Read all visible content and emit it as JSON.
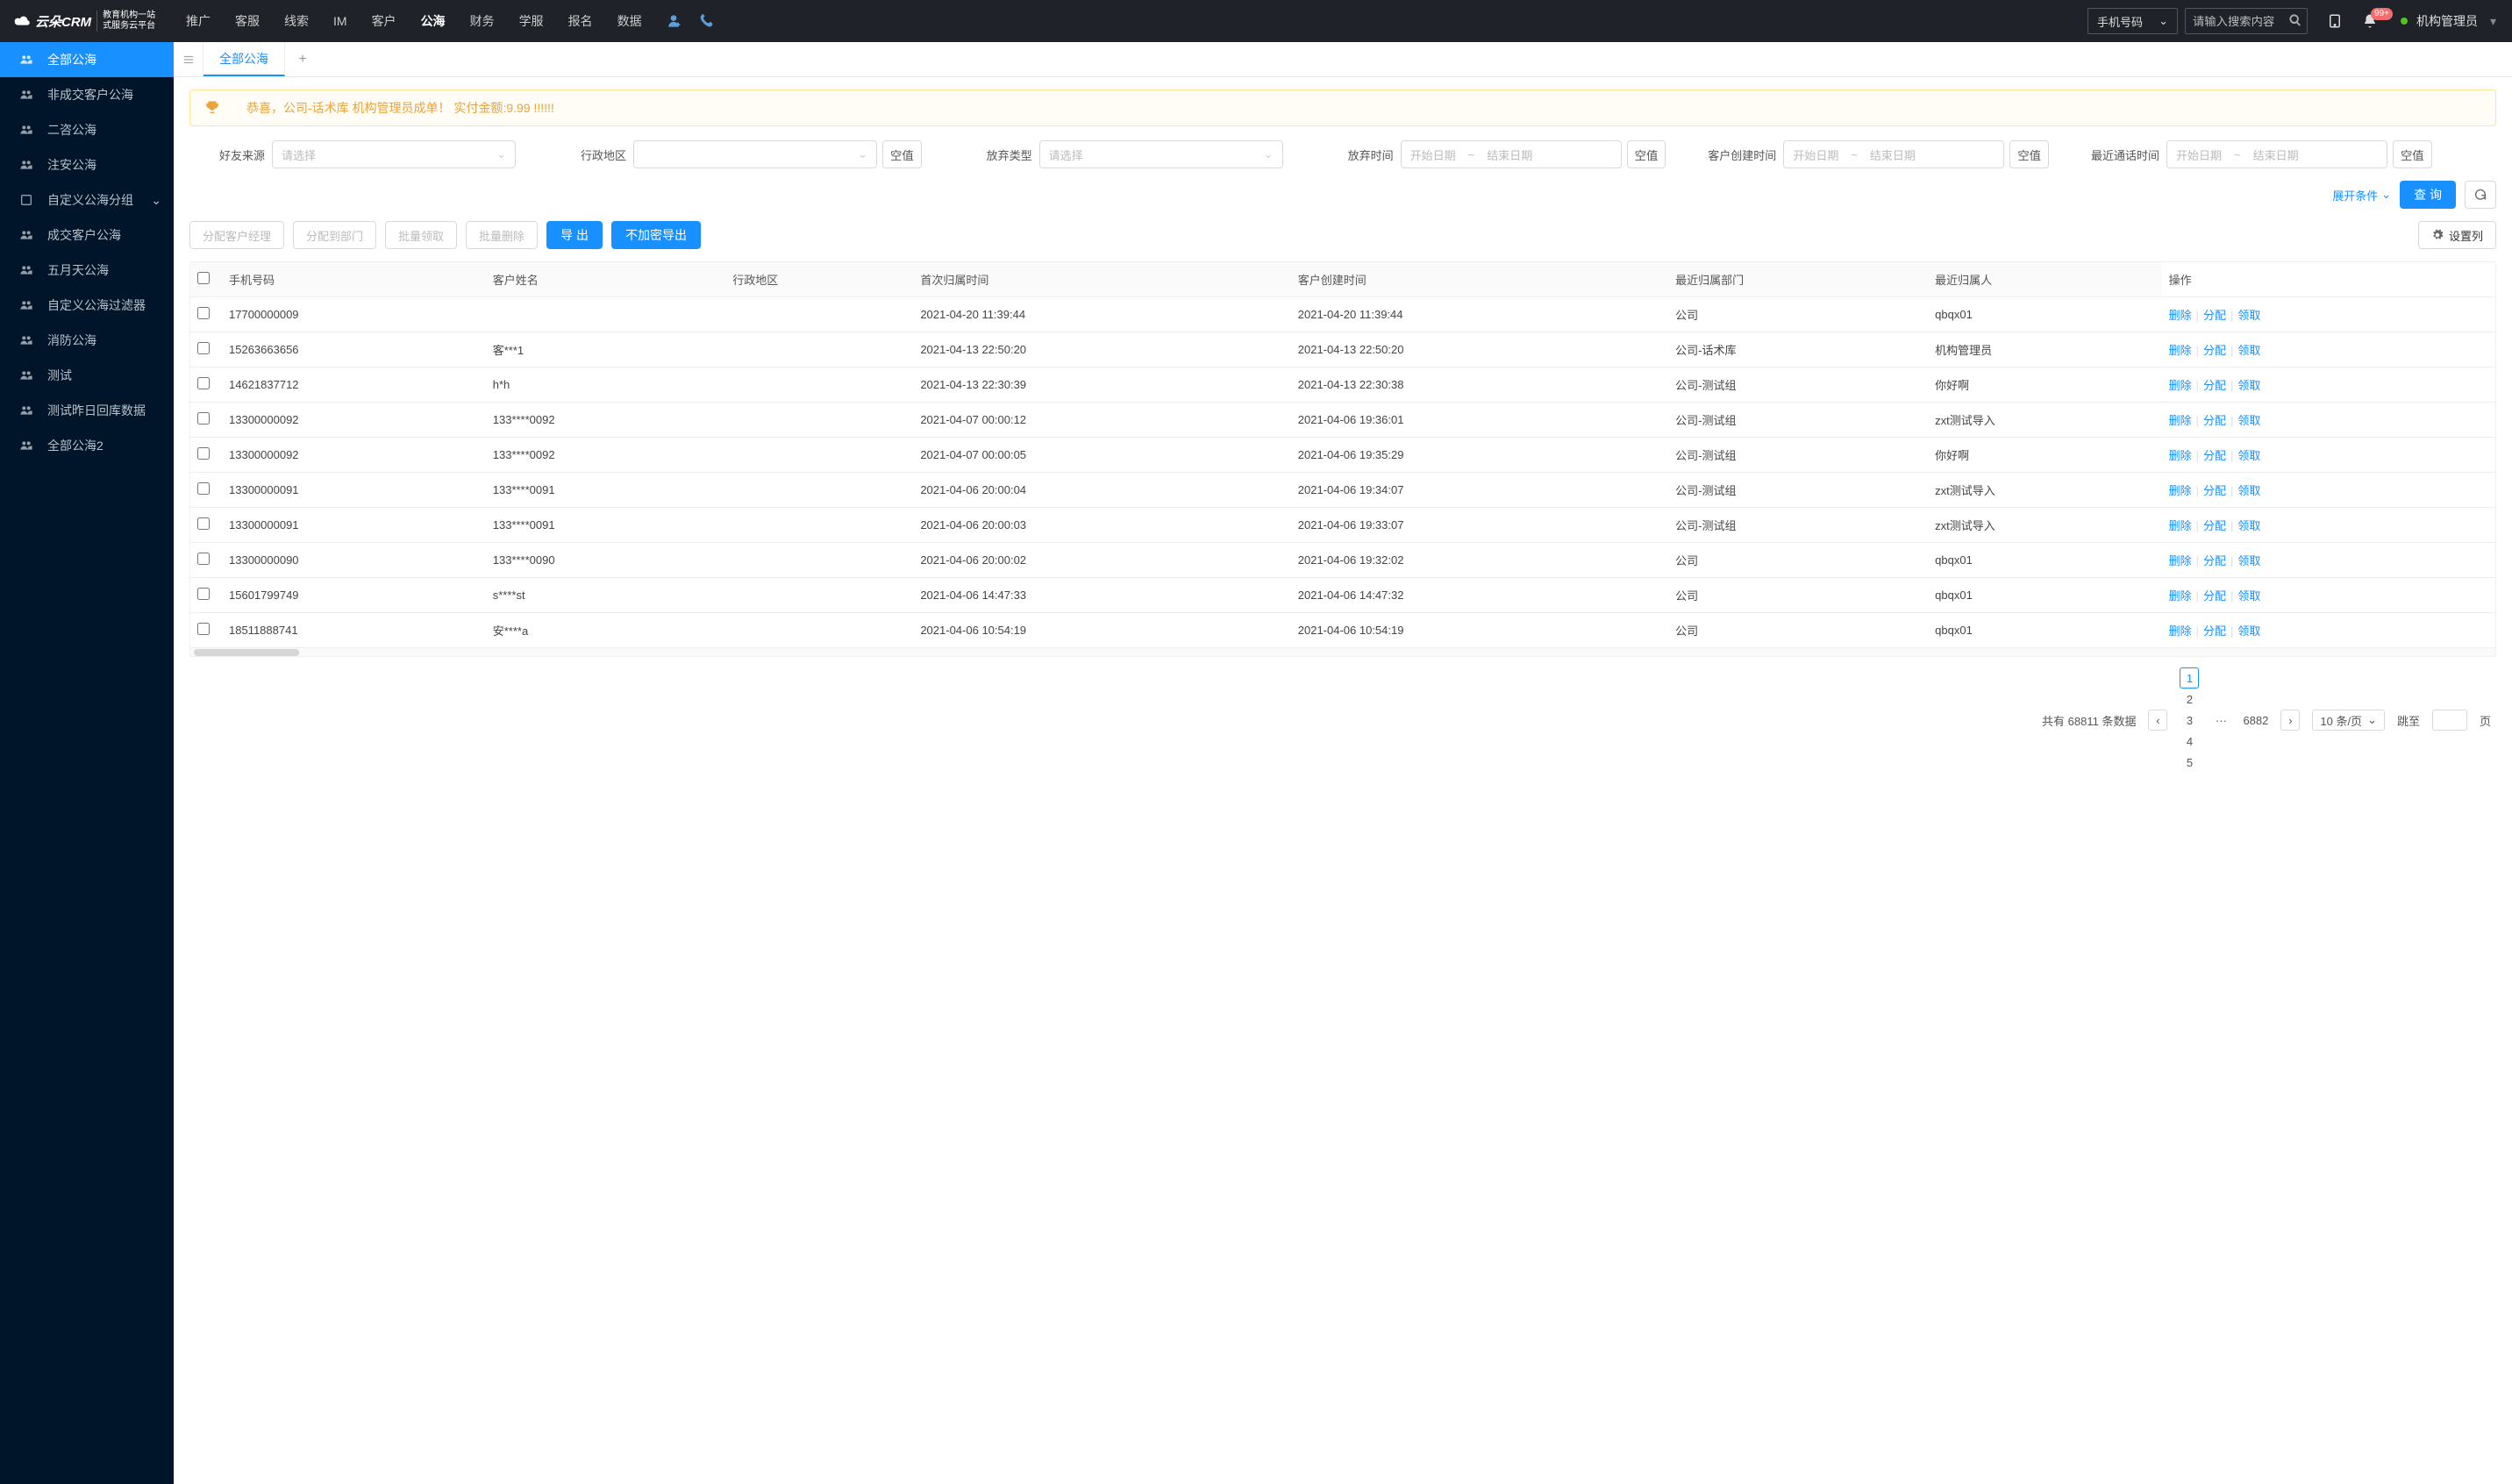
{
  "logo": {
    "main": "云朵CRM",
    "sub_url": "www.yunduocrm.com",
    "sub1": "教育机构一站",
    "sub2": "式服务云平台"
  },
  "nav": {
    "items": [
      "推广",
      "客服",
      "线索",
      "IM",
      "客户",
      "公海",
      "财务",
      "学服",
      "报名",
      "数据"
    ],
    "active": 5
  },
  "search": {
    "type": "手机号码",
    "placeholder": "请输入搜索内容"
  },
  "badge": "99+",
  "user": "机构管理员",
  "sidebar": [
    {
      "label": "全部公海",
      "icon": "users",
      "active": true
    },
    {
      "label": "非成交客户公海",
      "icon": "users"
    },
    {
      "label": "二咨公海",
      "icon": "users"
    },
    {
      "label": "注安公海",
      "icon": "users"
    },
    {
      "label": "自定义公海分组",
      "icon": "square",
      "expandable": true
    },
    {
      "label": "成交客户公海",
      "icon": "users"
    },
    {
      "label": "五月天公海",
      "icon": "users"
    },
    {
      "label": "自定义公海过滤器",
      "icon": "users"
    },
    {
      "label": "消防公海",
      "icon": "users"
    },
    {
      "label": "测试",
      "icon": "users"
    },
    {
      "label": "测试昨日回库数据",
      "icon": "users"
    },
    {
      "label": "全部公海2",
      "icon": "users"
    }
  ],
  "tab": {
    "label": "全部公海"
  },
  "banner": "恭喜，公司-话术库  机构管理员成单！  实付金额:9.99 !!!!!!",
  "filters": {
    "friend_source": {
      "label": "好友来源",
      "placeholder": "请选择"
    },
    "admin_region": {
      "label": "行政地区"
    },
    "abandon_type": {
      "label": "放弃类型",
      "placeholder": "请选择"
    },
    "abandon_time": {
      "label": "放弃时间"
    },
    "create_time": {
      "label": "客户创建时间"
    },
    "recent_call": {
      "label": "最近通话时间"
    },
    "date_start": "开始日期",
    "date_end": "结束日期",
    "empty": "空值"
  },
  "controls": {
    "expand": "展开条件",
    "query": "查 询"
  },
  "actions": {
    "assign_mgr": "分配客户经理",
    "assign_dept": "分配到部门",
    "bulk_claim": "批量领取",
    "bulk_del": "批量删除",
    "export": "导 出",
    "export_plain": "不加密导出",
    "columns": "设置列"
  },
  "columns": [
    "手机号码",
    "客户姓名",
    "行政地区",
    "首次归属时间",
    "客户创建时间",
    "最近归属部门",
    "最近归属人",
    "操作"
  ],
  "ops": {
    "del": "删除",
    "assign": "分配",
    "claim": "领取"
  },
  "rows": [
    {
      "phone": "17700000009",
      "name": "",
      "region": "",
      "first": "2021-04-20 11:39:44",
      "created": "2021-04-20 11:39:44",
      "dept": "公司",
      "owner": "qbqx01"
    },
    {
      "phone": "15263663656",
      "name": "客***1",
      "region": "",
      "first": "2021-04-13 22:50:20",
      "created": "2021-04-13 22:50:20",
      "dept": "公司-话术库",
      "owner": "机构管理员"
    },
    {
      "phone": "14621837712",
      "name": "h*h",
      "region": "",
      "first": "2021-04-13 22:30:39",
      "created": "2021-04-13 22:30:38",
      "dept": "公司-测试组",
      "owner": "你好啊"
    },
    {
      "phone": "13300000092",
      "name": "133****0092",
      "region": "",
      "first": "2021-04-07 00:00:12",
      "created": "2021-04-06 19:36:01",
      "dept": "公司-测试组",
      "owner": "zxt测试导入"
    },
    {
      "phone": "13300000092",
      "name": "133****0092",
      "region": "",
      "first": "2021-04-07 00:00:05",
      "created": "2021-04-06 19:35:29",
      "dept": "公司-测试组",
      "owner": "你好啊"
    },
    {
      "phone": "13300000091",
      "name": "133****0091",
      "region": "",
      "first": "2021-04-06 20:00:04",
      "created": "2021-04-06 19:34:07",
      "dept": "公司-测试组",
      "owner": "zxt测试导入"
    },
    {
      "phone": "13300000091",
      "name": "133****0091",
      "region": "",
      "first": "2021-04-06 20:00:03",
      "created": "2021-04-06 19:33:07",
      "dept": "公司-测试组",
      "owner": "zxt测试导入"
    },
    {
      "phone": "13300000090",
      "name": "133****0090",
      "region": "",
      "first": "2021-04-06 20:00:02",
      "created": "2021-04-06 19:32:02",
      "dept": "公司",
      "owner": "qbqx01"
    },
    {
      "phone": "15601799749",
      "name": "s****st",
      "region": "",
      "first": "2021-04-06 14:47:33",
      "created": "2021-04-06 14:47:32",
      "dept": "公司",
      "owner": "qbqx01"
    },
    {
      "phone": "18511888741",
      "name": "安****a",
      "region": "",
      "first": "2021-04-06 10:54:19",
      "created": "2021-04-06 10:54:19",
      "dept": "公司",
      "owner": "qbqx01"
    }
  ],
  "pager": {
    "total_pre": "共有",
    "total": "68811",
    "total_suf": "条数据",
    "pages": [
      "1",
      "2",
      "3",
      "4",
      "5"
    ],
    "ellipsis": "···",
    "last": "6882",
    "size": "10 条/页",
    "jump_pre": "跳至",
    "jump_suf": "页"
  }
}
